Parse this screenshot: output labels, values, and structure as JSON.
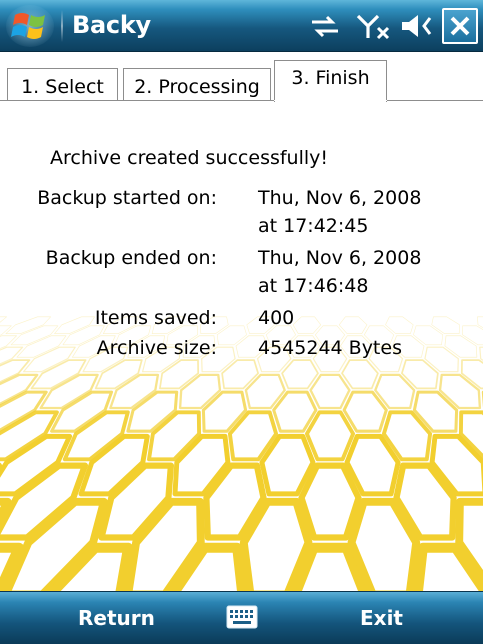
{
  "window": {
    "title": "Backy",
    "status_icons": [
      "sync-icon",
      "signal-off-icon",
      "speaker-icon",
      "close-icon"
    ]
  },
  "tabs": [
    {
      "label": "1. Select",
      "active": false
    },
    {
      "label": "2. Processing",
      "active": false
    },
    {
      "label": "3. Finish",
      "active": true
    }
  ],
  "result": {
    "message": "Archive created successfully!",
    "started_label": "Backup started on:",
    "started_date": "Thu, Nov 6, 2008",
    "started_time": "at 17:42:45",
    "ended_label": "Backup ended on:",
    "ended_date": "Thu, Nov 6, 2008",
    "ended_time": "at 17:46:48",
    "items_label": "Items saved:",
    "items_value": "400",
    "size_label": "Archive size:",
    "size_value": "4545244 Bytes"
  },
  "menubar": {
    "left_label": "Return",
    "right_label": "Exit",
    "center_icon": "keyboard-icon"
  },
  "colors": {
    "titlebar": "#16587f",
    "hex_outline": "#f2cf2e",
    "tab_border": "#8d8d8d"
  }
}
